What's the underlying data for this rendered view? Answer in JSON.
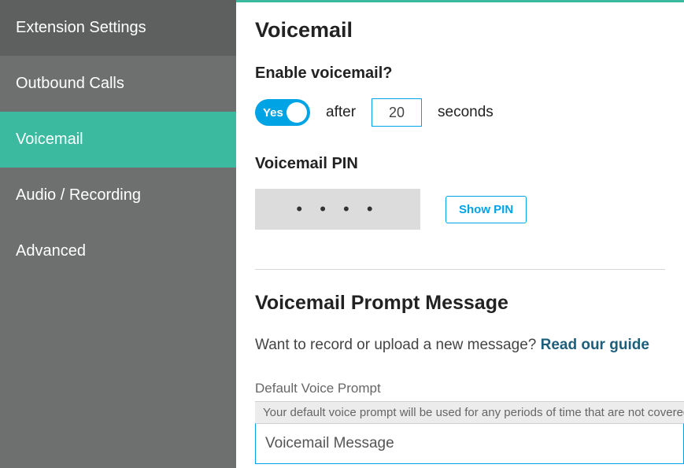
{
  "sidebar": {
    "items": [
      {
        "label": "Extension Settings"
      },
      {
        "label": "Outbound Calls"
      },
      {
        "label": "Voicemail"
      },
      {
        "label": "Audio / Recording"
      },
      {
        "label": "Advanced"
      }
    ]
  },
  "main": {
    "title": "Voicemail",
    "enable": {
      "label": "Enable voicemail?",
      "toggle_text": "Yes",
      "after_text": "after",
      "seconds_value": "20",
      "seconds_text": "seconds"
    },
    "pin": {
      "label": "Voicemail PIN",
      "masked": "• • • •",
      "show_btn": "Show PIN"
    },
    "prompt": {
      "title": "Voicemail Prompt Message",
      "text_prefix": "Want to record or upload a new message? ",
      "guide_link": "Read our guide",
      "default_label": "Default Voice Prompt",
      "default_info": "Your default voice prompt will be used for any periods of time that are not covered by the",
      "select_value": "Voicemail Message"
    }
  }
}
